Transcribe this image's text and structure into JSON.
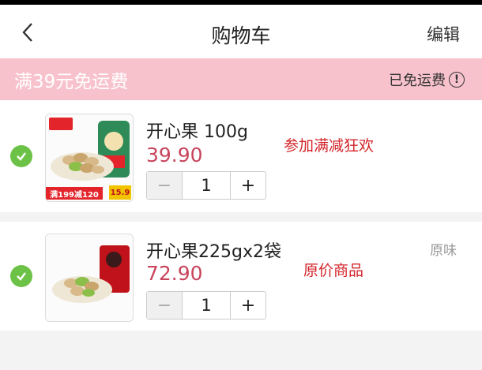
{
  "header": {
    "title": "购物车",
    "edit_label": "编辑"
  },
  "promo": {
    "text": "满39元免运费",
    "status": "已免运费"
  },
  "items": [
    {
      "name": "开心果 100g",
      "price": "39.90",
      "quantity": "1",
      "note": "参加满减狂欢",
      "variant": "",
      "image_tags": {
        "left": "满199减120",
        "right": "15.9"
      }
    },
    {
      "name": "开心果225gx2袋",
      "price": "72.90",
      "quantity": "1",
      "note": "原价商品",
      "variant": "原味"
    }
  ],
  "colors": {
    "promo_bg": "#f8c2cd",
    "price": "#c8455c",
    "check": "#6cc246",
    "note": "#d3242a"
  }
}
